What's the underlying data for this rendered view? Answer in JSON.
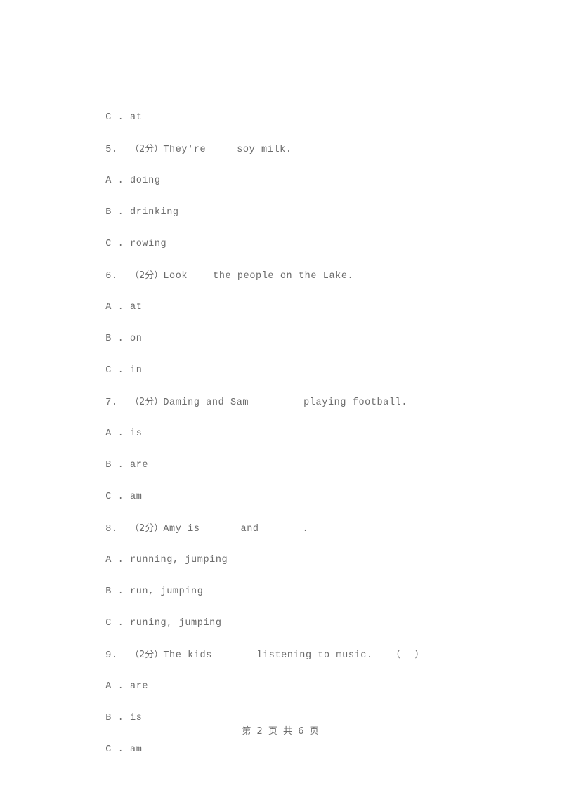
{
  "document": {
    "page_footer": "第 2 页 共 6 页",
    "current_page": "2",
    "total_pages": "6"
  },
  "lines": [
    {
      "kind": "option",
      "label": "C",
      "sep": " . ",
      "text": "at",
      "full": "C . at"
    }
  ],
  "questions": [
    {
      "number": "5.",
      "marks": "（2分）",
      "stem_before": "They're",
      "gap1_width": 44,
      "stem_after": "soy milk.",
      "tail": "",
      "options": [
        {
          "label": "A",
          "text": "doing",
          "full": "A . doing"
        },
        {
          "label": "B",
          "text": "drinking",
          "full": "B . drinking"
        },
        {
          "label": "C",
          "text": "rowing",
          "full": "C . rowing"
        }
      ]
    },
    {
      "number": "6.",
      "marks": "（2分）",
      "stem_before": "Look",
      "gap1_width": 36,
      "stem_after": "the people on the Lake.",
      "tail": "",
      "options": [
        {
          "label": "A",
          "text": "at",
          "full": "A . at"
        },
        {
          "label": "B",
          "text": "on",
          "full": "B . on"
        },
        {
          "label": "C",
          "text": "in",
          "full": "C . in"
        }
      ]
    },
    {
      "number": "7.",
      "marks": "（2分）",
      "stem_before": "Daming and Sam",
      "gap1_width": 78,
      "stem_after": "playing football.",
      "tail": "",
      "options": [
        {
          "label": "A",
          "text": "is",
          "full": "A . is"
        },
        {
          "label": "B",
          "text": "are",
          "full": "B . are"
        },
        {
          "label": "C",
          "text": "am",
          "full": "C . am"
        }
      ]
    },
    {
      "number": "8.",
      "marks": "（2分）",
      "stem_before": "Amy is",
      "gap1_width": 58,
      "stem_mid": "and",
      "gap2_width": 62,
      "stem_after": ".",
      "tail": "",
      "options": [
        {
          "label": "A",
          "text": "running, jumping",
          "full": "A . running, jumping"
        },
        {
          "label": "B",
          "text": "run, jumping",
          "full": "B . run, jumping"
        },
        {
          "label": "C",
          "text": "runing, jumping",
          "full": "C . runing, jumping"
        }
      ]
    },
    {
      "number": "9.",
      "marks": "（2分）",
      "stem_before": "The kids",
      "blank_underline_width": 46,
      "stem_after": "listening to music.",
      "tail": "（     ）",
      "answer_bracket_open": "(",
      "answer_bracket_close": ")",
      "options": [
        {
          "label": "A",
          "text": "are",
          "full": "A . are"
        },
        {
          "label": "B",
          "text": "is",
          "full": "B . is"
        },
        {
          "label": "C",
          "text": "am",
          "full": "C . am"
        }
      ]
    }
  ],
  "colors": {
    "page_background": "#ffffff",
    "text": "#6b6b6b",
    "rule": "#8a8a8a"
  }
}
